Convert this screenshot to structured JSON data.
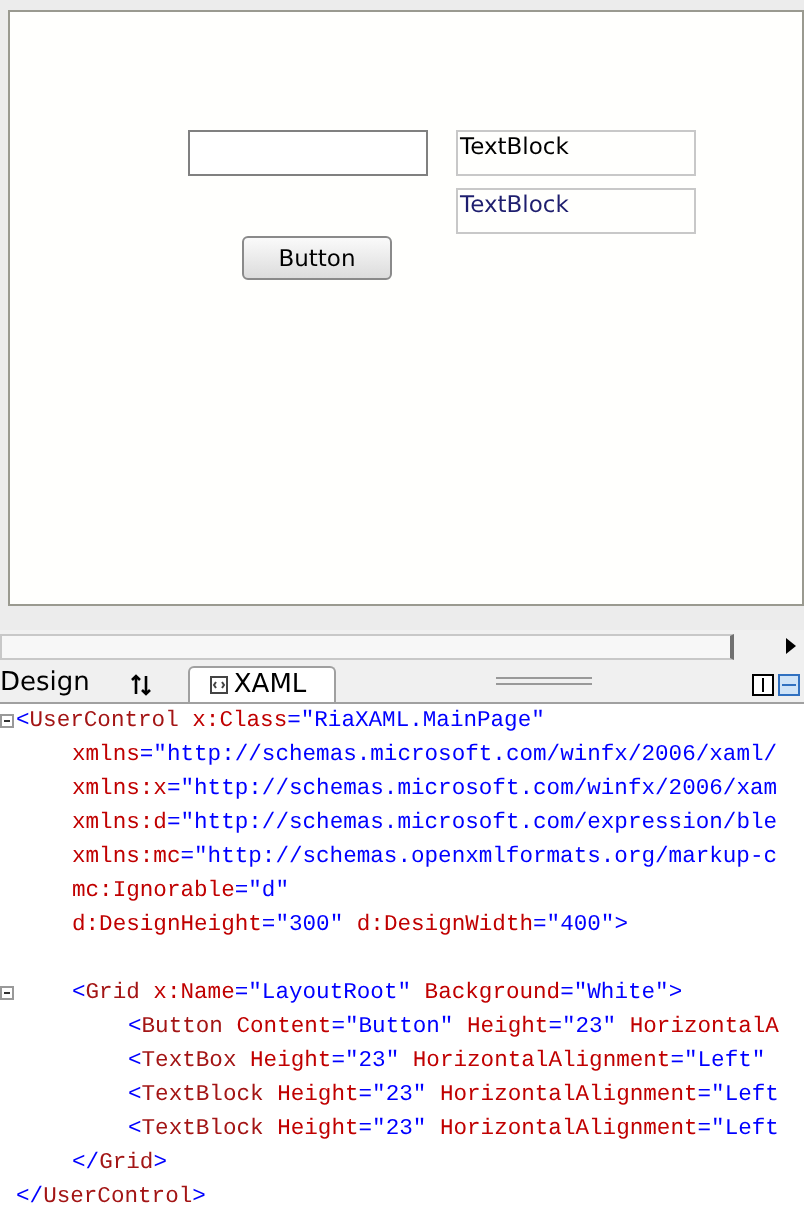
{
  "designer": {
    "text_blocks": [
      {
        "text": "TextBlock",
        "color": "#000000"
      },
      {
        "text": "TextBlock",
        "color": "#1e1e6e"
      }
    ],
    "button": {
      "label": "Button"
    }
  },
  "tabs": [
    {
      "label": "Design",
      "selected": false
    },
    {
      "label": "XAML",
      "selected": true
    }
  ],
  "code_lines": [
    {
      "kind": "code",
      "tokens": [
        {
          "kind": "punct",
          "text": "<"
        },
        {
          "kind": "tag",
          "text": "UserControl"
        },
        {
          "kind": "attr",
          "text": " x:Class"
        },
        {
          "kind": "punct",
          "text": "=\"RiaXAML.MainPage\""
        }
      ],
      "children": [
        {
          "kind": "code",
          "tokens": [
            {
              "kind": "attr",
              "text": "xmlns"
            },
            {
              "kind": "punct",
              "text": "=\"http://schemas.microsoft.com/winfx/2006/xaml/"
            }
          ]
        },
        {
          "kind": "code",
          "tokens": [
            {
              "kind": "attr",
              "text": "xmlns:x"
            },
            {
              "kind": "punct",
              "text": "=\"http://schemas.microsoft.com/winfx/2006/xam"
            }
          ]
        },
        {
          "kind": "code",
          "tokens": [
            {
              "kind": "attr",
              "text": "xmlns:d"
            },
            {
              "kind": "punct",
              "text": "=\"http://schemas.microsoft.com/expression/ble"
            }
          ]
        },
        {
          "kind": "code",
          "tokens": [
            {
              "kind": "attr",
              "text": "xmlns:mc"
            },
            {
              "kind": "punct",
              "text": "=\"http://schemas.openxmlformats.org/markup-c"
            }
          ]
        },
        {
          "kind": "code",
          "tokens": [
            {
              "kind": "attr",
              "text": "mc:Ignorable"
            },
            {
              "kind": "punct",
              "text": "=\"d\""
            }
          ]
        },
        {
          "kind": "code",
          "tokens": [
            {
              "kind": "attr",
              "text": "d:DesignHeight"
            },
            {
              "kind": "punct",
              "text": "=\"300\""
            },
            {
              "kind": "attr",
              "text": " d:DesignWidth"
            },
            {
              "kind": "punct",
              "text": "=\"400\">"
            }
          ]
        },
        {
          "kind": "blank"
        },
        {
          "kind": "code",
          "tokens": [
            {
              "kind": "punct",
              "text": "<"
            },
            {
              "kind": "tag",
              "text": "Grid"
            },
            {
              "kind": "attr",
              "text": " x:Name"
            },
            {
              "kind": "punct",
              "text": "=\"LayoutRoot\""
            },
            {
              "kind": "attr",
              "text": " Background"
            },
            {
              "kind": "punct",
              "text": "=\"White\">"
            }
          ],
          "children": [
            {
              "kind": "code",
              "tokens": [
                {
                  "kind": "punct",
                  "text": "<"
                },
                {
                  "kind": "tag",
                  "text": "Button"
                },
                {
                  "kind": "attr",
                  "text": " Content"
                },
                {
                  "kind": "punct",
                  "text": "=\"Button\""
                },
                {
                  "kind": "attr",
                  "text": " Height"
                },
                {
                  "kind": "punct",
                  "text": "=\"23\""
                },
                {
                  "kind": "attr",
                  "text": " HorizontalA"
                }
              ]
            },
            {
              "kind": "code",
              "tokens": [
                {
                  "kind": "punct",
                  "text": "<"
                },
                {
                  "kind": "tag",
                  "text": "TextBox"
                },
                {
                  "kind": "attr",
                  "text": " Height"
                },
                {
                  "kind": "punct",
                  "text": "=\"23\""
                },
                {
                  "kind": "attr",
                  "text": " HorizontalAlignment"
                },
                {
                  "kind": "punct",
                  "text": "=\"Left\""
                }
              ]
            },
            {
              "kind": "code",
              "tokens": [
                {
                  "kind": "punct",
                  "text": "<"
                },
                {
                  "kind": "tag",
                  "text": "TextBlock"
                },
                {
                  "kind": "attr",
                  "text": " Height"
                },
                {
                  "kind": "punct",
                  "text": "=\"23\""
                },
                {
                  "kind": "attr",
                  "text": " HorizontalAlignment"
                },
                {
                  "kind": "punct",
                  "text": "=\"Left"
                }
              ]
            },
            {
              "kind": "code",
              "tokens": [
                {
                  "kind": "punct",
                  "text": "<"
                },
                {
                  "kind": "tag",
                  "text": "TextBlock"
                },
                {
                  "kind": "attr",
                  "text": " Height"
                },
                {
                  "kind": "punct",
                  "text": "=\"23\""
                },
                {
                  "kind": "attr",
                  "text": " HorizontalAlignment"
                },
                {
                  "kind": "punct",
                  "text": "=\"Left"
                }
              ]
            }
          ]
        },
        {
          "kind": "code",
          "tokens": [
            {
              "kind": "punct",
              "text": "</"
            },
            {
              "kind": "tag",
              "text": "Grid"
            },
            {
              "kind": "punct",
              "text": ">"
            }
          ]
        }
      ]
    },
    {
      "kind": "code",
      "tokens": [
        {
          "kind": "punct",
          "text": "</"
        },
        {
          "kind": "tag",
          "text": "UserControl"
        },
        {
          "kind": "punct",
          "text": ">"
        }
      ]
    }
  ]
}
